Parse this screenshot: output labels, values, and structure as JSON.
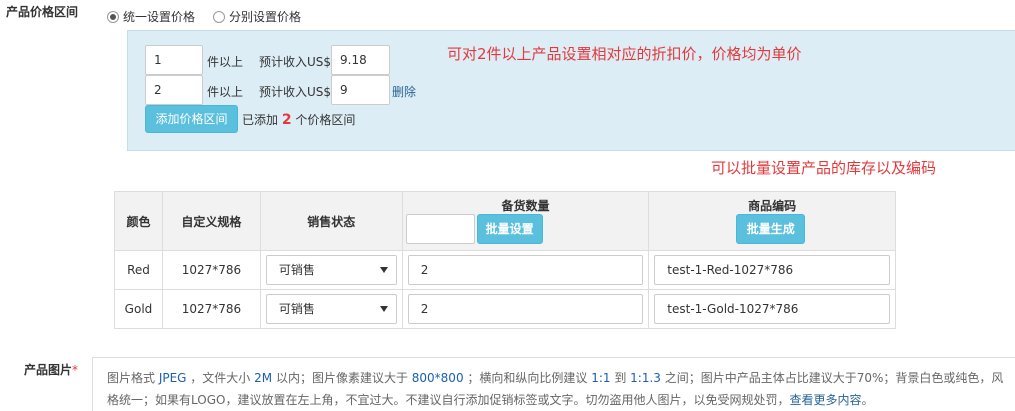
{
  "price_section": {
    "label": "产品价格区间",
    "option_unified": "统一设置价格",
    "option_separate": "分别设置价格",
    "tiers": [
      {
        "qty": "1",
        "qty_suffix": "件以上",
        "income_label": "预计收入US$",
        "price": "9.18",
        "delete_label": ""
      },
      {
        "qty": "2",
        "qty_suffix": "件以上",
        "income_label": "预计收入US$",
        "price": "9",
        "delete_label": "删除"
      }
    ],
    "add_button": "添加价格区间",
    "added_prefix": "已添加",
    "added_count": "2",
    "added_suffix": "个价格区间",
    "annotation": "可对2件以上产品设置相对应的折扣价，价格均为单价"
  },
  "inventory_annotation": "可以批量设置产品的库存以及编码",
  "sku_table": {
    "headers": {
      "color": "颜色",
      "spec": "自定义规格",
      "status": "销售状态",
      "stock": "备货数量",
      "code": "商品编码"
    },
    "batch_set_button": "批量设置",
    "batch_stock_value": "",
    "batch_generate_button": "批量生成",
    "rows": [
      {
        "color": "Red",
        "spec": "1027*786",
        "status": "可销售",
        "stock": "2",
        "code": "test-1-Red-1027*786"
      },
      {
        "color": "Gold",
        "spec": "1027*786",
        "status": "可销售",
        "stock": "2",
        "code": "test-1-Gold-1027*786"
      }
    ]
  },
  "image_section": {
    "label": "产品图片",
    "required_mark": "*",
    "t1": "图片格式 ",
    "fmt": "JPEG",
    "t2": " ，文件大小 ",
    "size": "2M",
    "t3": " 以内；图片像素建议大于 ",
    "pixels": "800*800",
    "t4": " ；横向和纵向比例建议 ",
    "r1": "1:1",
    "t5": " 到 ",
    "r2": "1:1.3",
    "t6": " 之间；图片中产品主体占比建议大于70%；背景白色或纯色，风",
    "line2": "格统一；如果有LOGO，建议放置在左上角，不宜过大。不建议自行添加促销标签或文字。切勿盗用他人图片，以免受网规处罚，",
    "more_link": "查看更多内容",
    "end": "。"
  }
}
